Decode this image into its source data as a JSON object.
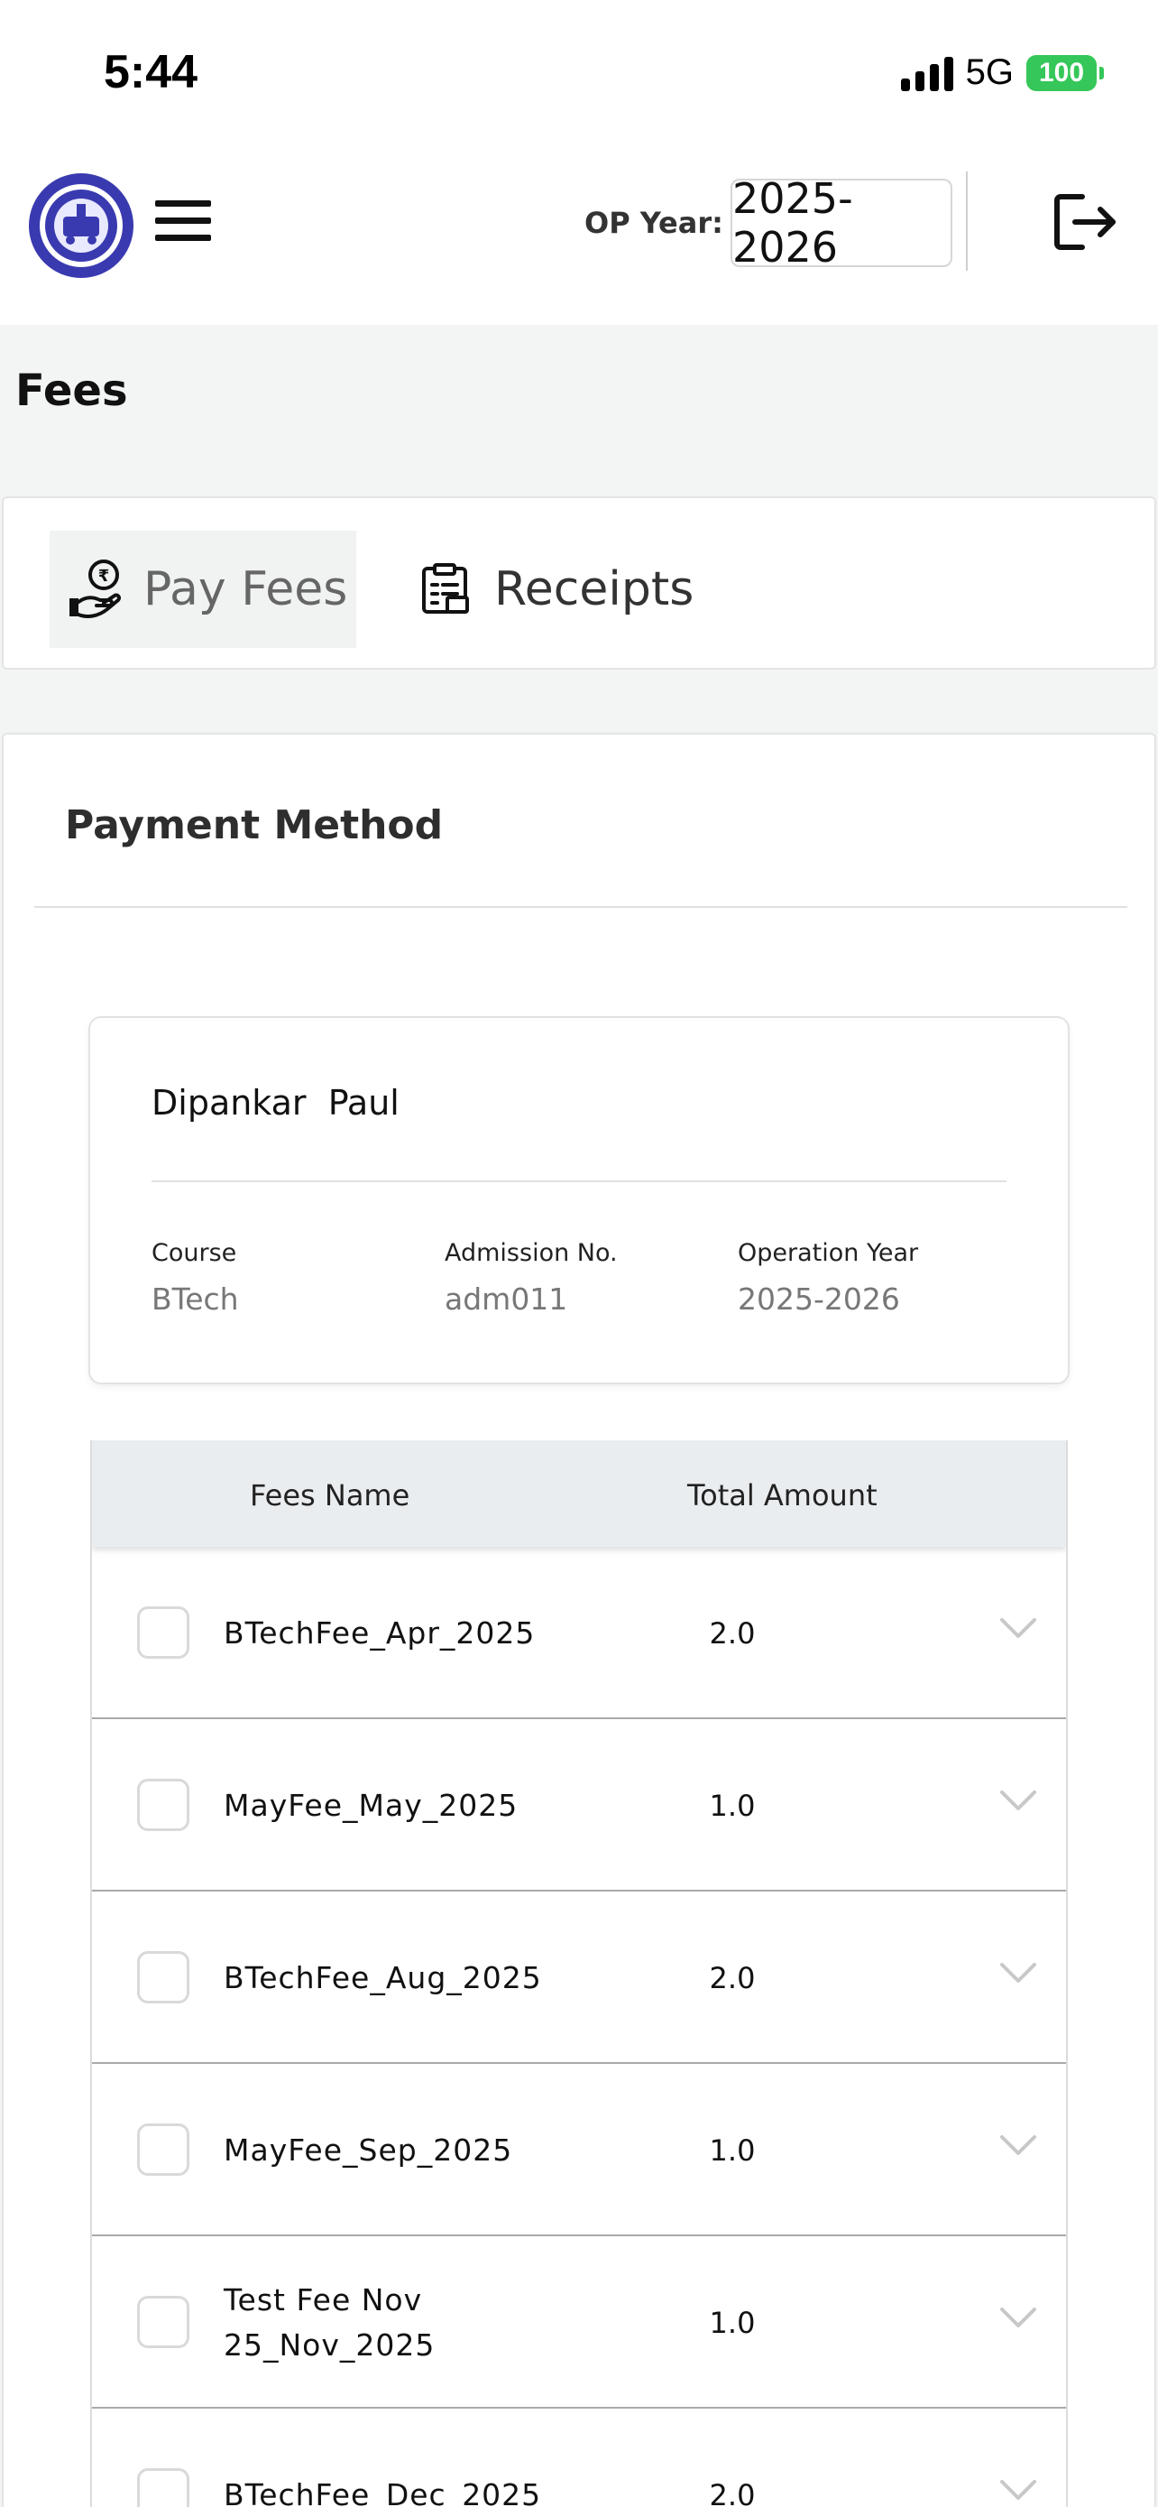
{
  "status_bar": {
    "time": "5:44",
    "network": "5G",
    "battery": "100"
  },
  "header": {
    "logo_icon": "indian-railways-logo-icon",
    "menu_icon": "hamburger-menu-icon",
    "op_year_label": "OP Year:",
    "op_year_value": "2025-2026",
    "logout_icon": "logout-icon"
  },
  "page": {
    "title": "Fees"
  },
  "tabs": [
    {
      "label": "Pay Fees",
      "icon": "hand-coin-icon",
      "active": true
    },
    {
      "label": "Receipts",
      "icon": "receipt-icon",
      "active": false
    }
  ],
  "payment": {
    "title": "Payment Method",
    "student": {
      "name": "Dipankar  Paul",
      "fields": [
        {
          "label": "Course",
          "value": "BTech"
        },
        {
          "label": "Admission No.",
          "value": "adm011"
        },
        {
          "label": "Operation Year",
          "value": "2025-2026"
        }
      ]
    },
    "fees_table": {
      "headers": {
        "name": "Fees Name",
        "amount": "Total Amount"
      },
      "rows": [
        {
          "name": "BTechFee_Apr_2025",
          "amount": "2.0"
        },
        {
          "name": "MayFee_May_2025",
          "amount": "1.0"
        },
        {
          "name": "BTechFee_Aug_2025",
          "amount": "2.0"
        },
        {
          "name": "MayFee_Sep_2025",
          "amount": "1.0"
        },
        {
          "name": "Test Fee Nov\n25_Nov_2025",
          "amount": "1.0"
        },
        {
          "name": "BTechFee_Dec_2025",
          "amount": "2.0"
        }
      ]
    }
  },
  "colors": {
    "battery": "#35c759",
    "logo_blue": "#3a3ab0",
    "table_header_bg": "#eaedf0",
    "active_tab_bg": "#f1f2f2"
  }
}
